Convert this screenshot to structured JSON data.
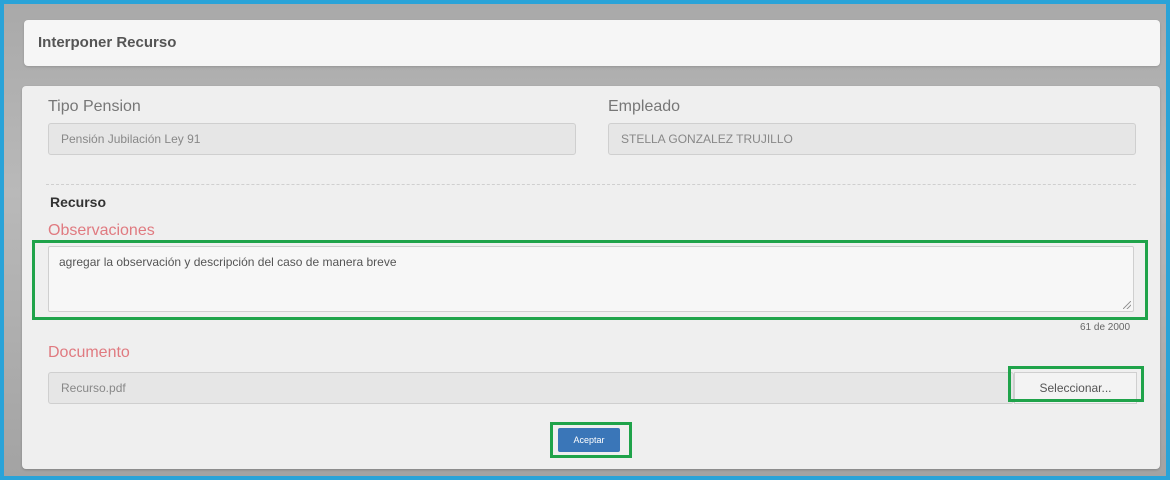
{
  "window": {
    "title": "Interponer Recurso"
  },
  "form": {
    "tipo_pension": {
      "label": "Tipo Pension",
      "value": "Pensión Jubilación Ley 91"
    },
    "empleado": {
      "label": "Empleado",
      "value": "STELLA GONZALEZ TRUJILLO"
    }
  },
  "recurso": {
    "section_title": "Recurso",
    "observaciones": {
      "label": "Observaciones",
      "value": "agregar la observación y descripción del caso de manera breve",
      "counter": "61 de 2000"
    },
    "documento": {
      "label": "Documento",
      "value": "Recurso.pdf",
      "select_label": "Seleccionar..."
    }
  },
  "actions": {
    "accept_label": "Aceptar"
  },
  "colors": {
    "frame_border": "#2aa3d8",
    "highlight": "#1fa34a",
    "required_label": "#e07a80",
    "primary_button": "#3a76b8"
  }
}
